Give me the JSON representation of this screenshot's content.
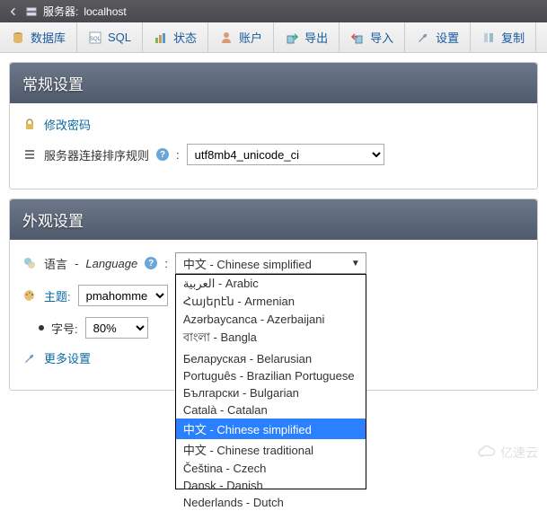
{
  "header": {
    "server_label": "服务器:",
    "server_name": "localhost"
  },
  "tabs": {
    "db": "数据库",
    "sql": "SQL",
    "status": "状态",
    "accounts": "账户",
    "export": "导出",
    "import": "导入",
    "settings": "设置",
    "replication": "复制"
  },
  "general": {
    "title": "常规设置",
    "change_password": "修改密码",
    "collation_label": "服务器连接排序规则",
    "collation_value": "utf8mb4_unicode_ci"
  },
  "appearance": {
    "title": "外观设置",
    "language_label_zh": "语言",
    "language_label_en": "Language",
    "language_value": "中文 - Chinese simplified",
    "theme_label": "主题:",
    "theme_value": "pmahomme",
    "fontsize_label": "字号:",
    "fontsize_value": "80%",
    "more_settings": "更多设置"
  },
  "language_options": [
    "العربية - Arabic",
    "Հայերէն - Armenian",
    "Azərbaycanca - Azerbaijani",
    "বাংলা - Bangla",
    "Беларуская - Belarusian",
    "Português - Brazilian Portuguese",
    "Български - Bulgarian",
    "Català - Catalan",
    "中文 - Chinese simplified",
    "中文 - Chinese traditional",
    "Čeština - Czech",
    "Dansk - Danish",
    "Nederlands - Dutch"
  ],
  "watermark": "亿速云"
}
